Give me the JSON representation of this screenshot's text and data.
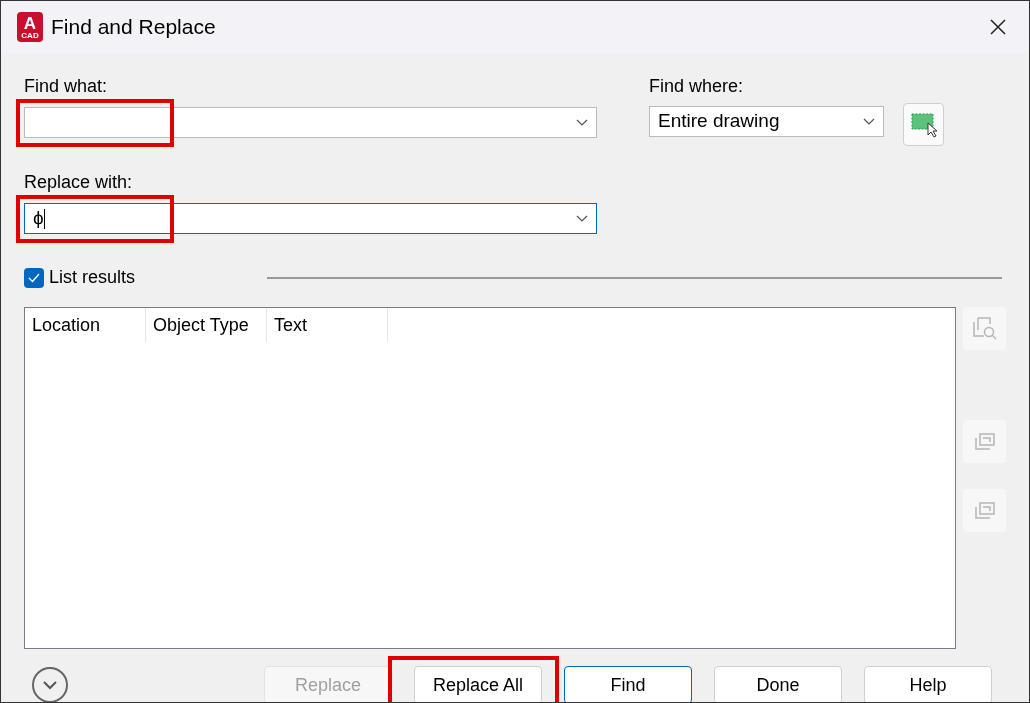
{
  "window": {
    "title": "Find and Replace",
    "app_badge": "A",
    "app_badge_sub": "CAD"
  },
  "find_what": {
    "label": "Find what:",
    "highlighted": true
  },
  "replace_with": {
    "label": "Replace with:",
    "value": "ϕ",
    "highlighted": true
  },
  "find_where": {
    "label": "Find where:",
    "value": "Entire drawing"
  },
  "list_results": {
    "label": "List results",
    "checked": true
  },
  "table": {
    "columns": [
      "Location",
      "Object Type",
      "Text"
    ]
  },
  "buttons": [
    {
      "label": "Replace",
      "disabled": true,
      "default": false,
      "highlighted": false
    },
    {
      "label": "Replace All",
      "disabled": false,
      "default": false,
      "highlighted": true
    },
    {
      "label": "Find",
      "disabled": false,
      "default": true,
      "highlighted": false
    },
    {
      "label": "Done",
      "disabled": false,
      "default": false,
      "highlighted": false
    },
    {
      "label": "Help",
      "disabled": false,
      "default": false,
      "highlighted": false
    }
  ]
}
